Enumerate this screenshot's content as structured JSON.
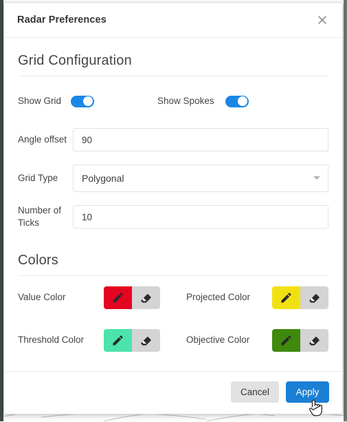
{
  "dialog": {
    "title": "Radar Preferences",
    "close_icon": "close-icon"
  },
  "sections": {
    "grid": {
      "heading": "Grid Configuration",
      "show_grid": {
        "label": "Show Grid",
        "value": "on"
      },
      "show_spokes": {
        "label": "Show Spokes",
        "value": "on"
      },
      "angle_offset": {
        "label": "Angle offset",
        "value": "90"
      },
      "grid_type": {
        "label": "Grid Type",
        "value": "Polygonal",
        "caret_icon": "chevron-down-icon"
      },
      "number_of_ticks": {
        "label": "Number of Ticks",
        "value": "10"
      }
    },
    "colors": {
      "heading": "Colors",
      "items": [
        {
          "label": "Value Color",
          "color": "#e40521",
          "pencil_icon": "pencil-icon",
          "clear_icon": "eraser-icon"
        },
        {
          "label": "Projected Color",
          "color": "#f2e112",
          "pencil_icon": "pencil-icon",
          "clear_icon": "eraser-icon"
        },
        {
          "label": "Threshold Color",
          "color": "#4ce4ac",
          "pencil_icon": "pencil-icon",
          "clear_icon": "eraser-icon"
        },
        {
          "label": "Objective Color",
          "color": "#3f8a0d",
          "pencil_icon": "pencil-icon",
          "clear_icon": "eraser-icon"
        }
      ]
    }
  },
  "footer": {
    "cancel_label": "Cancel",
    "apply_label": "Apply"
  },
  "theme": {
    "accent": "#1b7fd4",
    "toggle_on": "#1b87e6",
    "clear_button_bg": "#d4d4d4"
  },
  "cursor": {
    "icon": "pointer-hand-cursor"
  }
}
